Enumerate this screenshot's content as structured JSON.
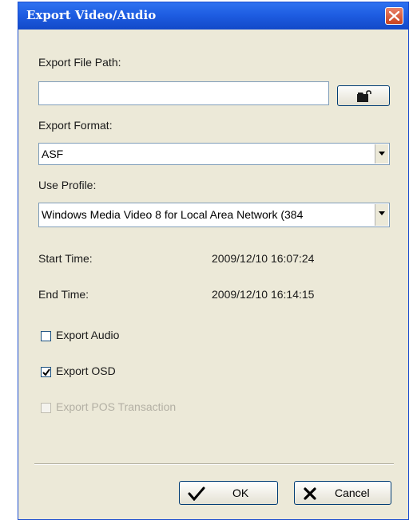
{
  "window": {
    "title": "Export Video/Audio"
  },
  "export_path": {
    "label": "Export File Path:",
    "value": ""
  },
  "export_format": {
    "label": "Export Format:",
    "selected": "ASF"
  },
  "profile": {
    "label": "Use Profile:",
    "selected": "Windows Media Video 8 for Local Area Network (384"
  },
  "start_time": {
    "label": "Start Time:",
    "value": "2009/12/10 16:07:24"
  },
  "end_time": {
    "label": "End Time:",
    "value": "2009/12/10 16:14:15"
  },
  "options": {
    "export_audio": {
      "label": "Export Audio",
      "checked": false
    },
    "export_osd": {
      "label": "Export OSD",
      "checked": true
    },
    "export_pos": {
      "label": "Export POS Transaction",
      "checked": false,
      "enabled": false
    }
  },
  "buttons": {
    "ok": "OK",
    "cancel": "Cancel"
  },
  "icons": {
    "close": "close-icon",
    "browse": "folder-icon",
    "ok": "check-icon",
    "cancel": "x-icon",
    "dropdown": "chevron-down-icon"
  }
}
